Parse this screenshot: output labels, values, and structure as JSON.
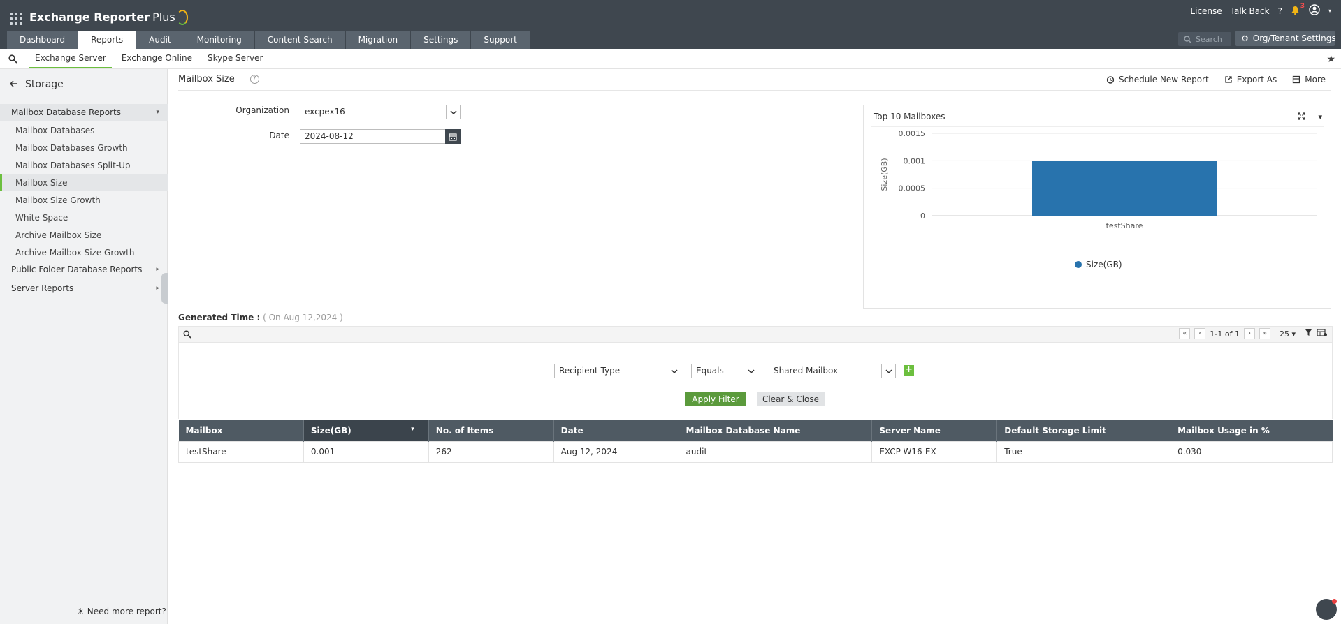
{
  "header": {
    "app_name": "Exchange Reporter",
    "app_name_suffix": "Plus",
    "links": [
      "License",
      "Talk Back"
    ],
    "help": "?",
    "notifications_count": "3",
    "search_placeholder": "Search",
    "org_settings": "Org/Tenant Settings",
    "tabs": [
      "Dashboard",
      "Reports",
      "Audit",
      "Monitoring",
      "Content Search",
      "Migration",
      "Settings",
      "Support"
    ],
    "active_tab": "Reports"
  },
  "subnav": {
    "tabs": [
      "Exchange Server",
      "Exchange Online",
      "Skype Server"
    ],
    "active": "Exchange Server"
  },
  "sidebar": {
    "back_label": "Storage",
    "groups": [
      {
        "label": "Mailbox Database Reports",
        "open": true
      },
      {
        "label": "Public Folder Database Reports",
        "open": false
      },
      {
        "label": "Server Reports",
        "open": false
      }
    ],
    "items": [
      "Mailbox Databases",
      "Mailbox Databases Growth",
      "Mailbox Databases Split-Up",
      "Mailbox Size",
      "Mailbox Size Growth",
      "White Space",
      "Archive Mailbox Size",
      "Archive Mailbox Size Growth"
    ],
    "active_item": "Mailbox Size",
    "need_more": "Need more report?"
  },
  "report": {
    "title": "Mailbox Size",
    "actions": [
      "Schedule New Report",
      "Export As",
      "More"
    ],
    "organization_label": "Organization",
    "organization_value": "excpex16",
    "date_label": "Date",
    "date_value": "2024-08-12",
    "generated_label": "Generated Time :",
    "generated_value": "( On Aug 12,2024 )"
  },
  "chart_data": {
    "type": "bar",
    "title": "Top 10 Mailboxes",
    "categories": [
      "testShare"
    ],
    "series": [
      {
        "name": "Size(GB)",
        "values": [
          0.001
        ]
      }
    ],
    "ylabel": "Size(GB)",
    "ylim": [
      0,
      0.0015
    ],
    "yticks": [
      "0",
      "0.0005",
      "0.001",
      "0.0015"
    ],
    "color": "#2873ad",
    "grid": true,
    "legend": "bottom"
  },
  "pager": {
    "range": "1-1 of 1",
    "page_size": "25"
  },
  "filter": {
    "field": "Recipient Type",
    "operator": "Equals",
    "value": "Shared Mailbox",
    "apply": "Apply Filter",
    "clear": "Clear & Close"
  },
  "table": {
    "columns": [
      "Mailbox",
      "Size(GB)",
      "No. of Items",
      "Date",
      "Mailbox Database Name",
      "Server Name",
      "Default Storage Limit",
      "Mailbox Usage in %"
    ],
    "rows": [
      [
        "testShare",
        "0.001",
        "262",
        "Aug 12, 2024",
        "audit",
        "EXCP-W16-EX",
        "True",
        "0.030"
      ]
    ]
  }
}
